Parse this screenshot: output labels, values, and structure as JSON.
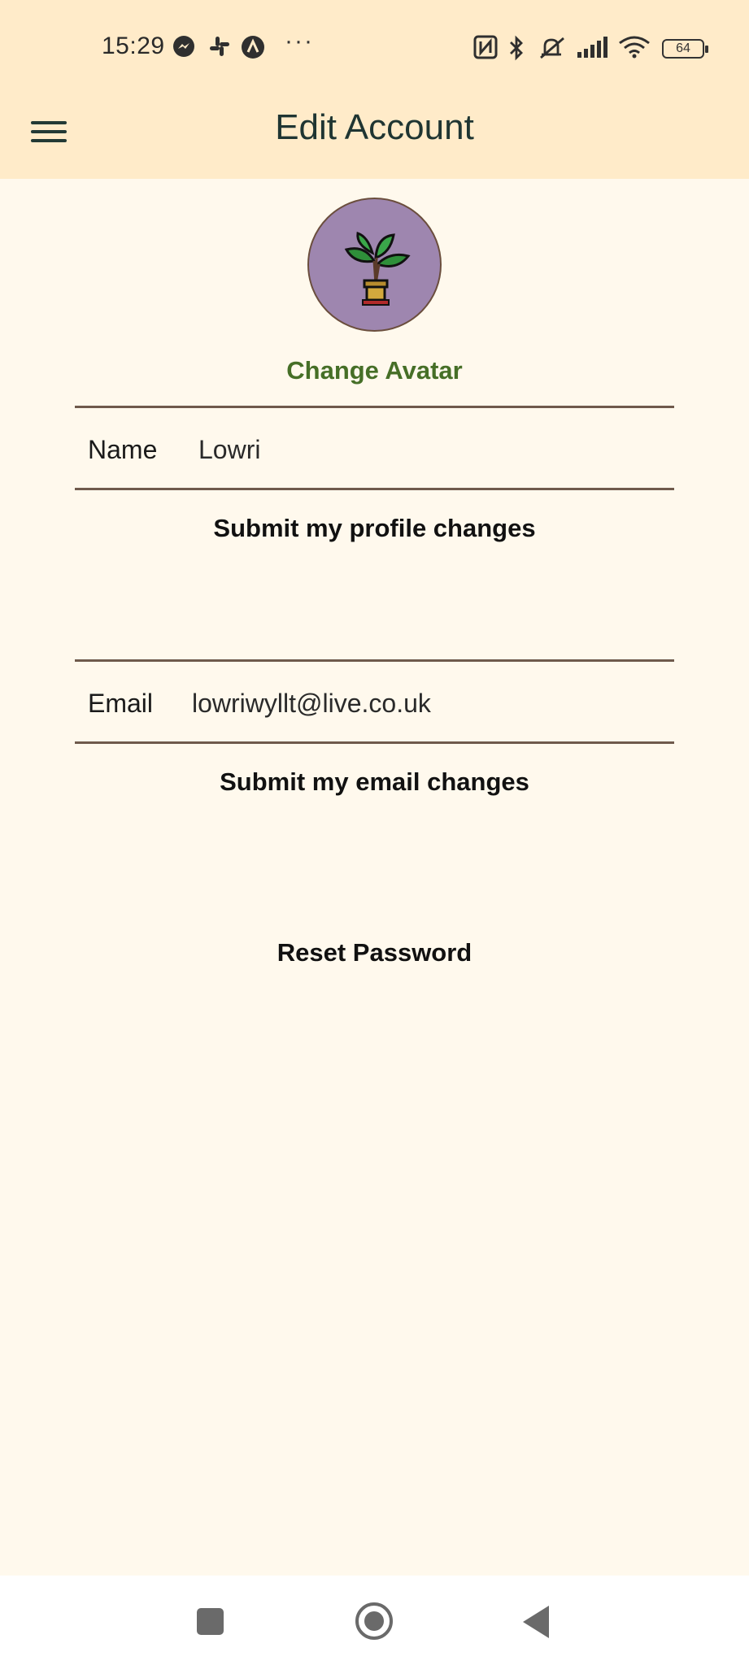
{
  "status_bar": {
    "time": "15:29",
    "left_icons": [
      "messenger-icon",
      "slack-icon",
      "arc-icon"
    ],
    "overflow": "···",
    "right_icons": [
      "nfc-icon",
      "bluetooth-icon",
      "silent-icon",
      "signal-icon",
      "wifi-icon"
    ],
    "battery_level": "64"
  },
  "app_bar": {
    "menu_icon": "hamburger-menu-icon",
    "title": "Edit Account"
  },
  "avatar": {
    "icon": "potted-plant-icon",
    "background_color": "#9e86af",
    "change_label": "Change Avatar"
  },
  "profile_form": {
    "name_label": "Name",
    "name_value": "Lowri",
    "submit_label": "Submit my profile changes"
  },
  "email_form": {
    "email_label": "Email",
    "email_value": "lowriwyllt@live.co.uk",
    "submit_label": "Submit my email changes"
  },
  "reset_password_label": "Reset Password",
  "nav_bar": {
    "buttons": [
      "recents-icon",
      "home-icon",
      "back-icon"
    ]
  },
  "colors": {
    "header_bg": "#ffebc9",
    "page_bg": "#fff9ed",
    "accent_green": "#466f27",
    "divider": "#6f5a4c"
  }
}
